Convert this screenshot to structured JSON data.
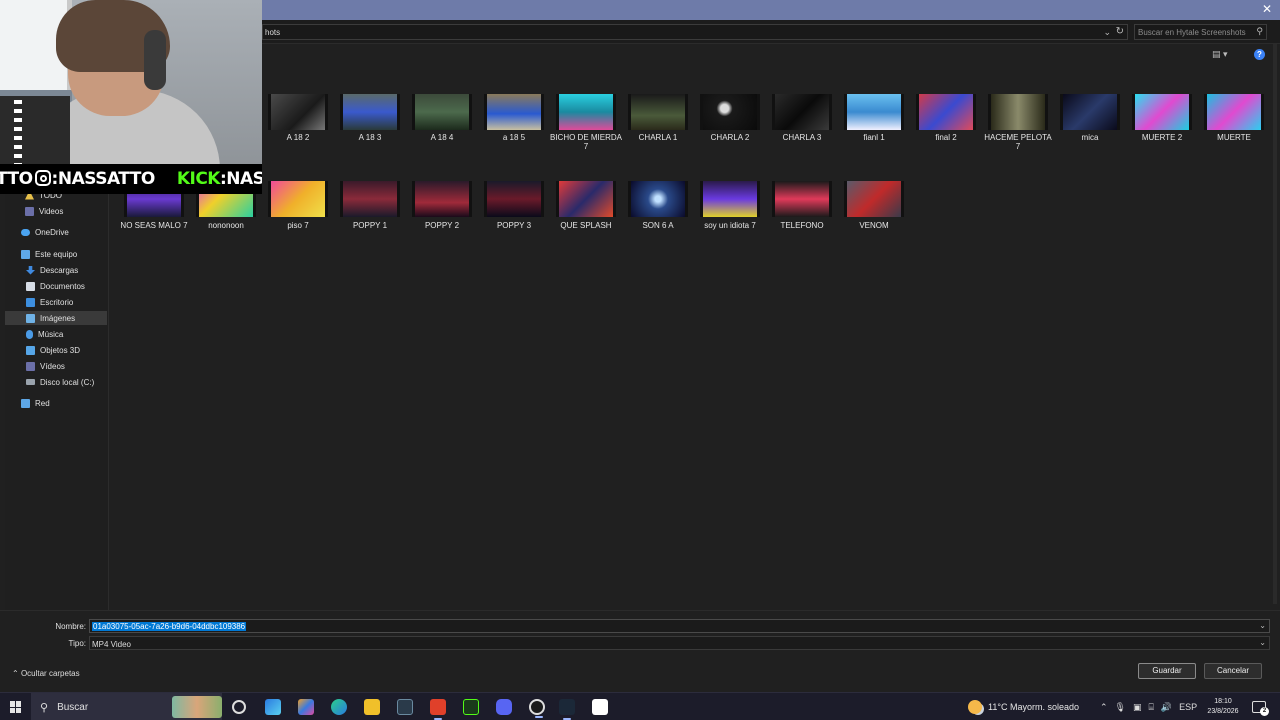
{
  "dialog": {
    "address_path": "hots",
    "search_placeholder": "Buscar en Hytale Screenshots",
    "help_label": "?"
  },
  "nav": {
    "items": [
      {
        "label": "TODO",
        "icon": "warning-icon"
      },
      {
        "label": "Videos",
        "icon": "video-folder-icon"
      },
      {
        "label": "OneDrive",
        "icon": "cloud-icon"
      },
      {
        "label": "Este equipo",
        "icon": "computer-icon"
      },
      {
        "label": "Descargas",
        "icon": "download-icon"
      },
      {
        "label": "Documentos",
        "icon": "document-icon"
      },
      {
        "label": "Escritorio",
        "icon": "desktop-icon"
      },
      {
        "label": "Imágenes",
        "icon": "pictures-icon"
      },
      {
        "label": "Música",
        "icon": "music-icon"
      },
      {
        "label": "Objetos 3D",
        "icon": "cube-icon"
      },
      {
        "label": "Vídeos",
        "icon": "video-folder-icon"
      },
      {
        "label": "Disco local (C:)",
        "icon": "drive-icon"
      },
      {
        "label": "Red",
        "icon": "network-icon"
      }
    ],
    "selected": "Imágenes"
  },
  "files": {
    "row1": [
      "A 18 2",
      "A 18 3",
      "A 18 4",
      "a 18 5",
      "BICHO DE MIERDA 7",
      "CHARLA 1",
      "CHARLA 2",
      "CHARLA 3",
      "fianl 1",
      "final 2",
      "HACEME PELOTA 7",
      "mica",
      "MUERTE 2",
      "MUERTE"
    ],
    "row2": [
      "NO SEAS MALO 7",
      "nononoon",
      "piso 7",
      "POPPY 1",
      "POPPY 2",
      "POPPY 3",
      "QUE SPLASH",
      "SON 6 A",
      "soy un idiota 7",
      "TELEFONO",
      "VENOM"
    ]
  },
  "overlay": {
    "ig_handle": ":NASSATTO",
    "ig_prefix": "TTO",
    "kick_word": "KICK",
    "kick_handle": ":NASSATT"
  },
  "form": {
    "name_label": "Nombre:",
    "name_value": "01a03075-05ac-7a26-b9d6-04ddbc109386",
    "type_label": "Tipo:",
    "type_value": "MP4 Video",
    "hide_folders": "Ocultar carpetas",
    "save_label": "Guardar",
    "cancel_label": "Cancelar"
  },
  "taskbar": {
    "search_text": "Buscar",
    "weather": "11°C  Mayorm. soleado",
    "lang": "ESP",
    "time": "18:10",
    "date": "23/8/2026",
    "notif_count": "2"
  }
}
